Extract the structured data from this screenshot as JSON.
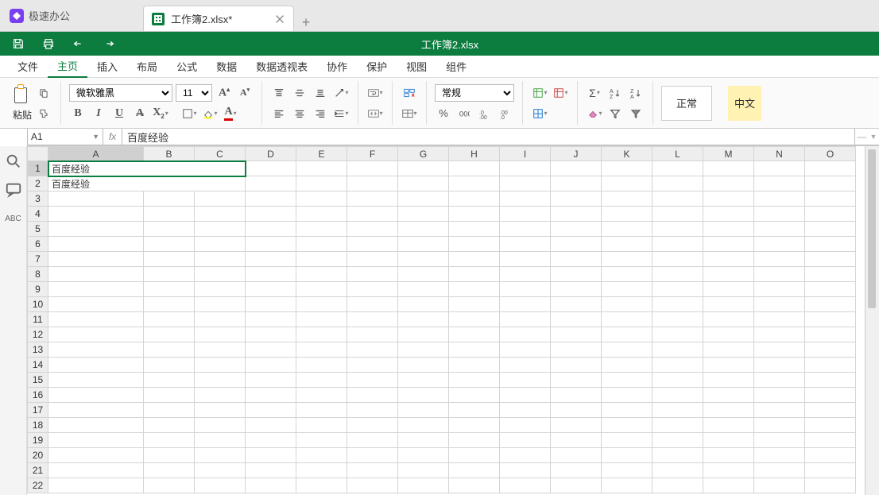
{
  "app": {
    "name": "极速办公"
  },
  "tab": {
    "label": "工作簿2.xlsx*"
  },
  "window_title": "工作簿2.xlsx",
  "menus": [
    "文件",
    "主页",
    "插入",
    "布局",
    "公式",
    "数据",
    "数据透视表",
    "协作",
    "保护",
    "视图",
    "组件"
  ],
  "active_menu": 1,
  "ribbon": {
    "paste_label": "粘贴",
    "font_name": "微软雅黑",
    "font_size": "11",
    "number_format": "常规",
    "status": "正常",
    "lang": "中文"
  },
  "name_box": "A1",
  "formula": "百度经验",
  "columns": [
    "A",
    "B",
    "C",
    "D",
    "E",
    "F",
    "G",
    "H",
    "I",
    "J",
    "K",
    "L",
    "M",
    "N",
    "O"
  ],
  "rows": 22,
  "cells": {
    "A1": "百度经验",
    "A2": "百度经验"
  },
  "merges": [
    {
      "r": 1,
      "c": 0,
      "colspan": 3
    },
    {
      "r": 2,
      "c": 0,
      "colspan": 3
    }
  ],
  "selected": {
    "row": 1,
    "col": 0
  }
}
